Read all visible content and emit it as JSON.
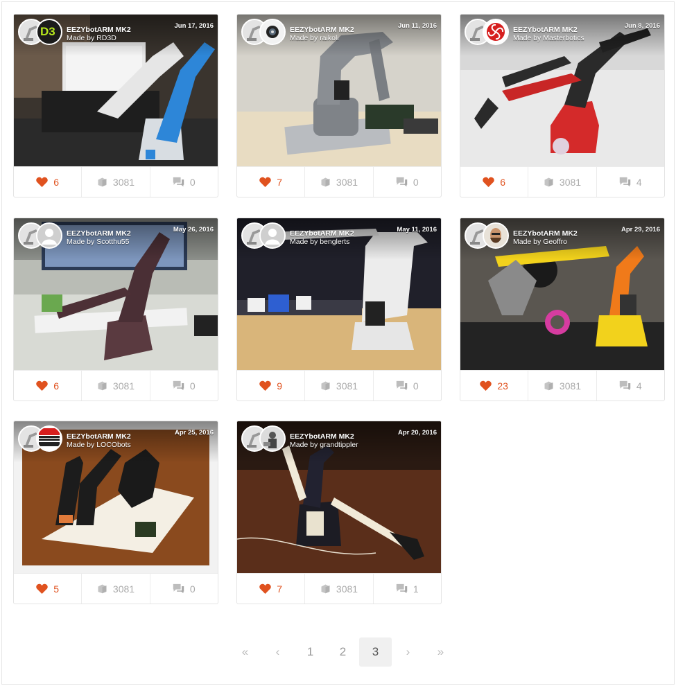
{
  "accent": "#e0521f",
  "cards": [
    {
      "thing": "EEZYbotARM MK2",
      "maker": "Made by RD3D",
      "date": "Jun 17, 2016",
      "likes": "6",
      "collections": "3081",
      "comments": "0",
      "avatar_icon": "user-avatar-icon"
    },
    {
      "thing": "EEZYbotARM MK2",
      "maker": "Made by raikoli",
      "date": "Jun 11, 2016",
      "likes": "7",
      "collections": "3081",
      "comments": "0",
      "avatar_icon": "user-avatar-icon"
    },
    {
      "thing": "EEZYbotARM MK2",
      "maker": "Made by Masterbotics",
      "date": "Jun 8, 2016",
      "likes": "6",
      "collections": "3081",
      "comments": "4",
      "avatar_icon": "user-avatar-icon"
    },
    {
      "thing": "EEZYbotARM MK2",
      "maker": "Made by Scotthu55",
      "date": "May 26, 2016",
      "likes": "6",
      "collections": "3081",
      "comments": "0",
      "avatar_icon": "default-avatar-icon"
    },
    {
      "thing": "EEZYbotARM MK2",
      "maker": "Made by benglerts",
      "date": "May 11, 2016",
      "likes": "9",
      "collections": "3081",
      "comments": "0",
      "avatar_icon": "default-avatar-icon"
    },
    {
      "thing": "EEZYbotARM MK2",
      "maker": "Made by Geoffro",
      "date": "Apr 29, 2016",
      "likes": "23",
      "collections": "3081",
      "comments": "4",
      "avatar_icon": "user-avatar-icon"
    },
    {
      "thing": "EEZYbotARM MK2",
      "maker": "Made by LOCObots",
      "date": "Apr 25, 2016",
      "likes": "5",
      "collections": "3081",
      "comments": "0",
      "avatar_icon": "user-avatar-icon"
    },
    {
      "thing": "EEZYbotARM MK2",
      "maker": "Made by grandtippler",
      "date": "Apr 20, 2016",
      "likes": "7",
      "collections": "3081",
      "comments": "1",
      "avatar_icon": "user-avatar-icon"
    }
  ],
  "pagination": {
    "first": "«",
    "prev": "‹",
    "pages": [
      "1",
      "2",
      "3"
    ],
    "current": "3",
    "next": "›",
    "last": "»"
  }
}
